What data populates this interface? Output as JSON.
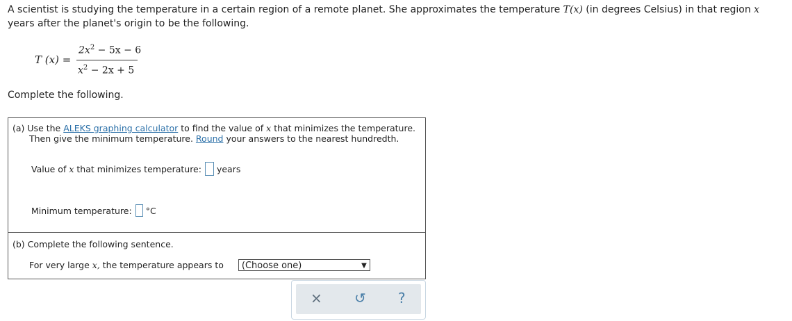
{
  "problem": {
    "line1": "A scientist is studying the temperature in a certain region of a remote planet. She approximates the temperature",
    "T_symbol": "T",
    "x_paren": "(x)",
    "line1b": "(in degrees Celsius) in that region",
    "x_end": "x",
    "line2": "years after the planet's origin to be the following."
  },
  "formula": {
    "lhs": "T (x) =",
    "numerator_a": "2x",
    "numerator_exp": "2",
    "numerator_b": "− 5x − 6",
    "denominator_a": "x",
    "denominator_exp": "2",
    "denominator_b": "− 2x + 5"
  },
  "complete_text": "Complete the following.",
  "part_a": {
    "label": "(a)",
    "text1": "Use the",
    "link_calc": "ALEKS graphing calculator",
    "text2": "to find the value of",
    "x": "x",
    "text3": "that minimizes the temperature.",
    "text4": "Then give the minimum temperature.",
    "link_round": "Round",
    "text5": "your answers to the nearest hundredth.",
    "q1_label_a": "Value of",
    "q1_x": "x",
    "q1_label_b": "that minimizes temperature:",
    "q1_unit": "years",
    "q2_label": "Minimum temperature:",
    "q2_unit": "°C"
  },
  "part_b": {
    "label": "(b)",
    "text": "Complete the following sentence.",
    "sentence_a": "For very large",
    "x": "x,",
    "sentence_b": "the temperature appears to",
    "select_value": "(Choose one)"
  },
  "toolbar": {
    "clear_icon": "×",
    "undo_icon": "↺",
    "help_icon": "?"
  }
}
